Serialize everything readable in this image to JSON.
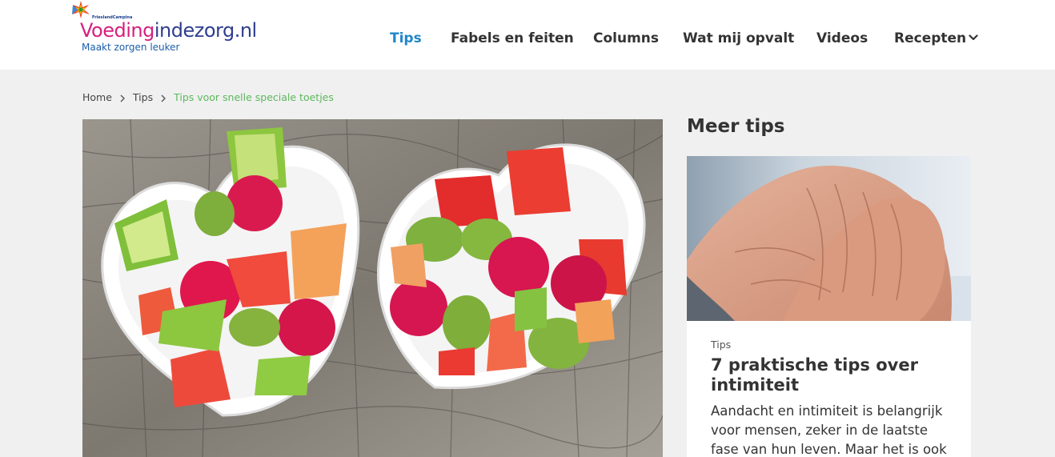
{
  "header": {
    "logo": {
      "company": "FrieslandCampina",
      "brand_part1": "Voeding",
      "brand_part2": "indezorg.nl",
      "tagline": "Maakt zorgen leuker"
    },
    "nav": [
      {
        "label": "Tips",
        "active": true
      },
      {
        "label": "Fabels en feiten",
        "active": false
      },
      {
        "label": "Columns",
        "active": false
      },
      {
        "label": "Wat mij opvalt",
        "active": false
      },
      {
        "label": "Videos",
        "active": false
      },
      {
        "label": "Recepten",
        "active": false,
        "dropdown": true
      }
    ],
    "accent": "#1f87c9"
  },
  "breadcrumb": [
    {
      "label": "Home"
    },
    {
      "label": "Tips"
    },
    {
      "label": "Tips voor snelle speciale toetjes",
      "current": true
    }
  ],
  "hero": {
    "image": "heart-shaped-bowls-fruit-salad"
  },
  "sidebar": {
    "title": "Meer tips",
    "card": {
      "image": "elderly-hands",
      "category": "Tips",
      "title": "7 praktische tips over intimiteit",
      "excerpt": "Aandacht en intimiteit is belangrijk voor mensen, zeker in de laatste fase van hun leven. Maar het is ook een…"
    }
  }
}
